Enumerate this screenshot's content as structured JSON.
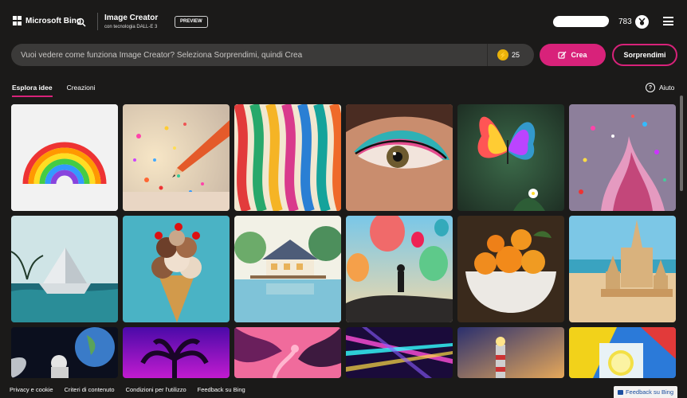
{
  "header": {
    "brand": "Microsoft Bing",
    "title": "Image Creator",
    "subtitle": "con tecnologia DALL-E 3",
    "preview_badge": "PREVIEW",
    "points": "783"
  },
  "prompt": {
    "placeholder": "Vuoi vedere come funziona Image Creator? Seleziona Sorprendimi, quindi Crea",
    "boosts": "25",
    "create_label": "Crea",
    "surprise_label": "Sorprendimi"
  },
  "tabs": [
    {
      "label": "Esplora idee",
      "active": true
    },
    {
      "label": "Creazioni",
      "active": false
    }
  ],
  "help_label": "Aiuto",
  "gallery_items": [
    "rainbow",
    "pencil-glitter",
    "colorful-ribbons",
    "eye-makeup",
    "rainbow-butterfly",
    "paint-splash",
    "paper-boat",
    "ice-cream-cone",
    "lake-house",
    "hot-air-balloons",
    "orange-bowl",
    "sand-castle",
    "astronaut-earth",
    "neon-palm",
    "pink-flamingos",
    "light-beams",
    "lighthouse",
    "pop-art-lemonade"
  ],
  "footer": {
    "links": [
      "Privacy e cookie",
      "Criteri di contenuto",
      "Condizioni per l'utilizzo",
      "Feedback su Bing"
    ],
    "feedback_button": "Feedback su Bing"
  },
  "colors": {
    "accent": "#d8227a",
    "background": "#1b1a19",
    "input_bg": "#3b3a39"
  }
}
